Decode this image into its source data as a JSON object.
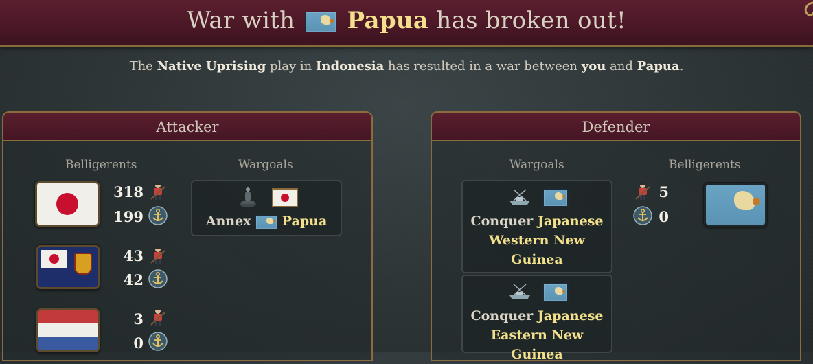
{
  "title": {
    "prefix": "War with",
    "country": "Papua",
    "suffix": "has broken out!"
  },
  "subtitle": {
    "t1": "The",
    "play": "Native Uprising",
    "t2": "play in",
    "region": "Indonesia",
    "t3": "has resulted in a war between",
    "you": "you",
    "t4": "and",
    "enemy": "Papua",
    "t5": "."
  },
  "attacker": {
    "header": "Attacker",
    "belligerents_label": "Belligerents",
    "wargoals_label": "Wargoals",
    "belligerents": [
      {
        "flag": "japan-flag",
        "army": "318",
        "navy": "199"
      },
      {
        "flag": "japan-protectorate-flag",
        "army": "43",
        "navy": "42"
      },
      {
        "flag": "dutch-flag",
        "army": "3",
        "navy": "0"
      }
    ],
    "wargoals": [
      {
        "action": "Annex",
        "target": "Papua"
      }
    ]
  },
  "defender": {
    "header": "Defender",
    "wargoals_label": "Wargoals",
    "belligerents_label": "Belligerents",
    "wargoals": [
      {
        "action": "Conquer",
        "target_line1": "Japanese",
        "target_line2": "Western New",
        "target_line3": "Guinea"
      },
      {
        "action": "Conquer",
        "target_line1": "Japanese",
        "target_line2": "Eastern New Guinea"
      }
    ],
    "belligerents": [
      {
        "flag": "papua-flag",
        "army": "5",
        "navy": "0"
      }
    ]
  },
  "colors": {
    "title_bar": "#4a1726",
    "gold_border": "#8b6c3e",
    "highlight_yellow": "#f2e08c",
    "background": "#2c3436"
  },
  "icons": [
    "soldier-icon",
    "anchor-icon",
    "cannon-icon",
    "warship-icon"
  ]
}
